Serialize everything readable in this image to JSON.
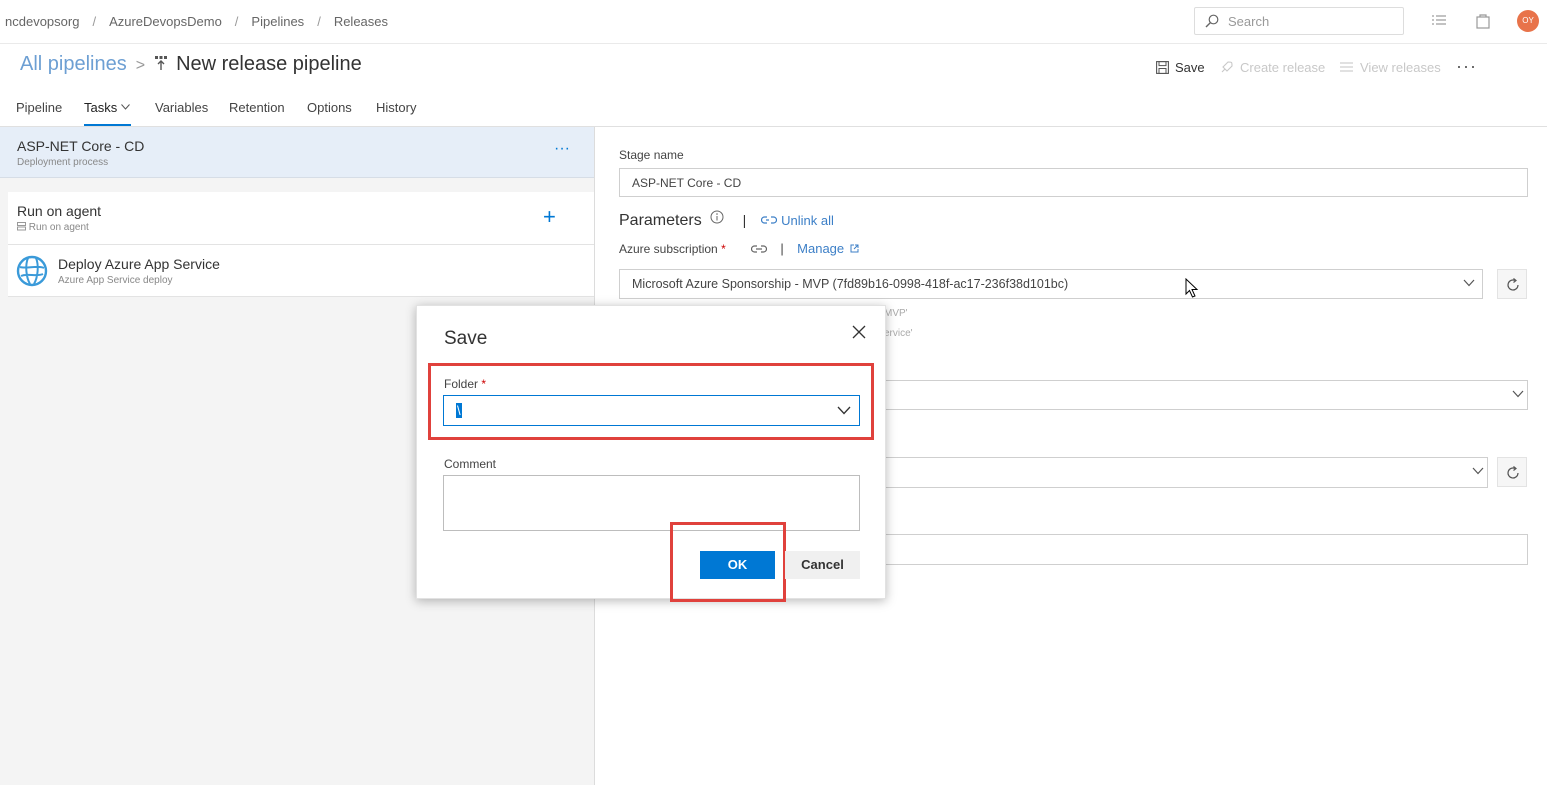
{
  "breadcrumbs": [
    "ncdevopsorg",
    "AzureDevopsDemo",
    "Pipelines",
    "Releases"
  ],
  "search": {
    "placeholder": "Search"
  },
  "user": {
    "initials": "OY",
    "avatar_color": "#e8734a"
  },
  "title": {
    "all_pipelines": "All pipelines",
    "pipeline_name": "New release pipeline"
  },
  "actions": {
    "save": "Save",
    "create_release": "Create release",
    "view_releases": "View releases",
    "more": "···"
  },
  "tabs": [
    "Pipeline",
    "Tasks",
    "Variables",
    "Retention",
    "Options",
    "History"
  ],
  "stage": {
    "name": "ASP-NET Core - CD",
    "subtitle": "Deployment process",
    "more": "···"
  },
  "agent_job": {
    "title": "Run on agent",
    "subtitle": "Run on agent"
  },
  "task": {
    "title": "Deploy Azure App Service",
    "subtitle": "Azure App Service deploy"
  },
  "right": {
    "stage_name_label": "Stage name",
    "stage_name_value": "ASP-NET Core - CD",
    "parameters_label": "Parameters",
    "separator": "|",
    "unlink_all": "Unlink all",
    "subscription_label": "Azure subscription",
    "required_mark": "*",
    "manage": "Manage",
    "subscription_value": "Microsoft Azure Sponsorship - MVP (7fd89b16-0998-418f-ac17-236f38d101bc)",
    "hint1": "MVP'",
    "hint2": "ervice'"
  },
  "dialog": {
    "title": "Save",
    "folder_label": "Folder",
    "required_mark": "*",
    "folder_value": "\\",
    "comment_label": "Comment",
    "comment_value": "",
    "ok": "OK",
    "cancel": "Cancel"
  },
  "colors": {
    "accent": "#0078d4",
    "link": "#3c7fc7",
    "highlight": "#e0413c",
    "selected_stage_bg": "#e6eef8"
  }
}
